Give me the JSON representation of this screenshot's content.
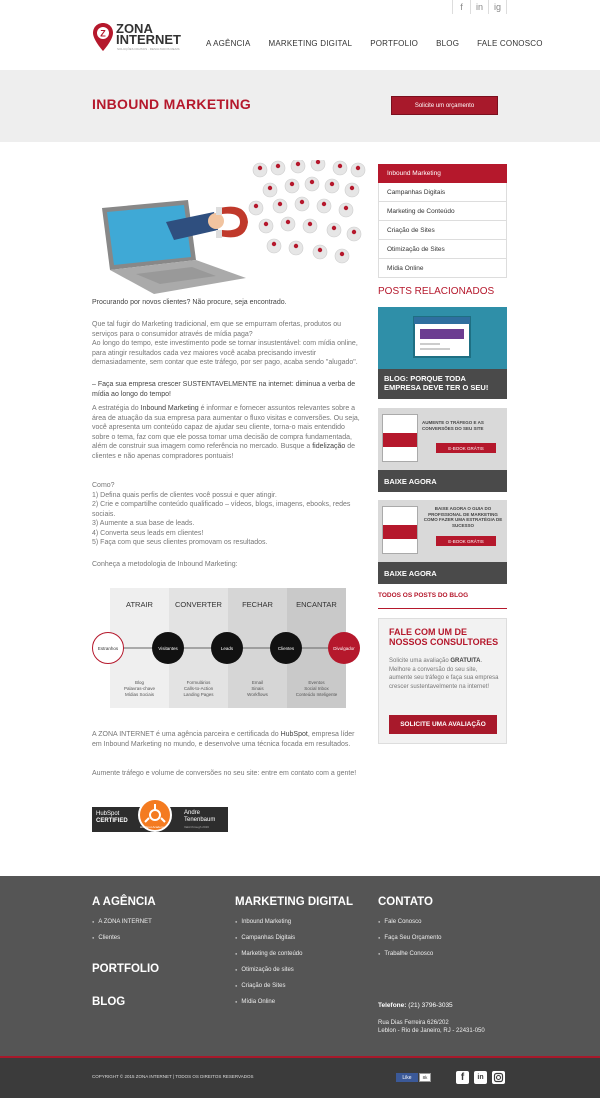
{
  "social_top": [
    "f",
    "in",
    "ig"
  ],
  "logo": {
    "line1": "ZONA",
    "line2": "INTERNET",
    "tagline": "SOLUÇÕES DIGITAIS · RESULTADOS REAIS"
  },
  "nav": [
    "A AGÊNCIA",
    "MARKETING DIGITAL",
    "PORTFOLIO",
    "BLOG",
    "FALE CONOSCO"
  ],
  "hero": {
    "title": "INBOUND MARKETING",
    "button": "Solicite um orçamento"
  },
  "sidebar": {
    "menu": [
      "Inbound Marketing",
      "Campanhas Digitais",
      "Marketing de Conteúdo",
      "Criação de Sites",
      "Otimização de Sites",
      "Mídia Online"
    ],
    "related_title": "POSTS RELACIONADOS",
    "cards": [
      {
        "caption": "BLOG: PORQUE TODA EMPRESA DEVE TER O SEU!"
      },
      {
        "caption": "BAIXE AGORA",
        "text": "AUMENTE O TRÁFEGO E AS CONVERSÕES DO SEU SITE",
        "cta": "E-BOOK GRÁTIS"
      },
      {
        "caption": "BAIXE AGORA",
        "text": "BAIXE AGORA O GUIA DO PROFISSIONAL DE MARKETING COMO FAZER UMA ESTRATÉGIA DE SUCESSO",
        "cta": "E-BOOK GRÁTIS"
      }
    ],
    "all_posts": "TODOS OS POSTS DO BLOG",
    "contact": {
      "title": "FALE COM UM DE NOSSOS CONSULTORES",
      "text_before": "Solicite uma avaliação ",
      "text_bold": "GRATUITA",
      "text_after": ". Melhore a conversão do seu site, aumente seu tráfego e faça sua empresa crescer sustentavelmente na internet!",
      "button": "SOLICITE UMA AVALIAÇÃO"
    }
  },
  "content": {
    "intro": "Procurando por novos clientes? Não procure, seja encontrado.",
    "p1": "Que tal fugir do Marketing tradicional, em que se empurram ofertas, produtos ou serviços para o consumidor através de mídia paga?",
    "p2": "Ao longo do tempo, este investimento pode se tornar insustentável: com mídia online, para atingir resultados cada vez maiores você acaba precisando investir demasiadamente, sem contar que este tráfego, por ser pago, acaba sendo \"alugado\".",
    "quote": "– Faça sua empresa crescer SUSTENTAVELMENTE na internet: diminua a verba de mídia ao longo do tempo!",
    "p3_a": "A estratégia do ",
    "p3_b": "Inbound Marketing",
    "p3_c": " é informar e fornecer assuntos relevantes sobre a área de atuação da sua empresa para aumentar o fluxo visitas e conversões. Ou seja, você apresenta um conteúdo capaz de ajudar seu cliente, torna-o mais entendido sobre o tema, faz com que ele possa tomar uma decisão de compra fundamentada, além de construir sua imagem como referência no mercado. Busque a ",
    "p3_d": "fidelização",
    "p3_e": " de clientes e não apenas compradores pontuais!",
    "steps_title": "Como?",
    "steps": [
      "1) Defina quais perfis de clientes você possui e quer atingir.",
      "2) Crie e compartilhe conteúdo qualificado – vídeos, blogs, imagens, ebooks, redes sociais.",
      "3) Aumente a sua base de leads.",
      "4) Converta seus leads em clientes!",
      "5) Faça com que seus clientes promovam os resultados."
    ],
    "method": "Conheça a metodologia de Inbound Marketing:",
    "p4_a": "A ZONA INTERNET é uma agência parceira e certificada do ",
    "p4_b": "HubSpot",
    "p4_c": ", empresa líder em Inbound Marketing no mundo, e desenvolve uma técnica focada em resultados.",
    "p5": "Aumente tráfego e volume de conversões no seu site: entre em contato com a gente!"
  },
  "diagram": {
    "stages": [
      "ATRAIR",
      "CONVERTER",
      "FECHAR",
      "ENCANTAR"
    ],
    "nodes": [
      "Estranhos",
      "Visitantes",
      "Leads",
      "Clientes",
      "Divulgador"
    ],
    "tools": [
      [
        "Blog",
        "Palavras-chave",
        "Mídias Sociais"
      ],
      [
        "Formulários",
        "Calls-to-Action",
        "Landing Pages"
      ],
      [
        "Email",
        "Sinais",
        "Workflows"
      ],
      [
        "Eventos",
        "Social Inbox",
        "Conteúdo Inteligente"
      ]
    ]
  },
  "badge": {
    "left1": "HubSpot",
    "left2": "CERTIFIED",
    "name1": "Andre",
    "name2": "Tenenbaum",
    "academy": "HubSpot Academy",
    "valid": "Valid through 2016"
  },
  "footer": {
    "col1_title": "A AGÊNCIA",
    "col1_links": [
      "A ZONA INTERNET",
      "Clientes"
    ],
    "portfolio": "PORTFOLIO",
    "blog": "BLOG",
    "col2_title": "MARKETING DIGITAL",
    "col2_links": [
      "Inbound Marketing",
      "Campanhas Digitais",
      "Marketing de conteúdo",
      "Otimização de sites",
      "Criação de Sites",
      "Mídia Online"
    ],
    "col3_title": "CONTATO",
    "col3_links": [
      "Fale Conosco",
      "Faça Seu Orçamento",
      "Trabalhe Conosco"
    ],
    "phone_label": "Telefone:",
    "phone": " (21) 3796-3035",
    "address1": "Rua Dias Ferreira 626/202",
    "address2": "Leblon - Rio de Janeiro, RJ - 22431-050",
    "copyright": "COPYRIGHT © 2015 ZONA INTERNET | TODOS OS DIREITOS RESERVADOS",
    "like": "Like",
    "like_count": "8k"
  },
  "colors": {
    "brand": "#b5182c",
    "footer": "#555555"
  }
}
